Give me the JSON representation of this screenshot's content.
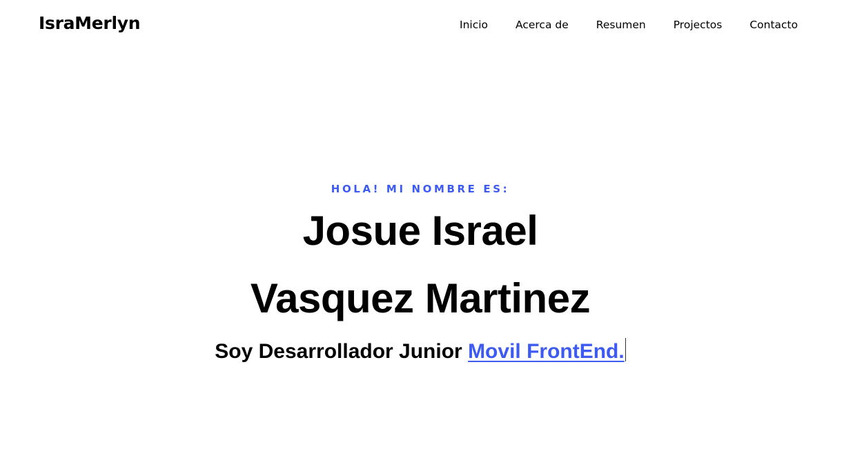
{
  "header": {
    "brand": "IsraMerlyn",
    "nav": [
      {
        "label": "Inicio"
      },
      {
        "label": "Acerca de"
      },
      {
        "label": "Resumen"
      },
      {
        "label": "Projectos"
      },
      {
        "label": "Contacto"
      }
    ]
  },
  "hero": {
    "greeting": "HOLA! MI NOMBRE ES:",
    "name_line_1": "Josue Israel",
    "name_line_2": "Vasquez Martinez",
    "tagline_prefix": "Soy Desarrollador Junior",
    "tagline_typed": "Movil FrontEnd."
  },
  "colors": {
    "accent": "#3d5af1",
    "text": "#000000",
    "background": "#ffffff"
  }
}
